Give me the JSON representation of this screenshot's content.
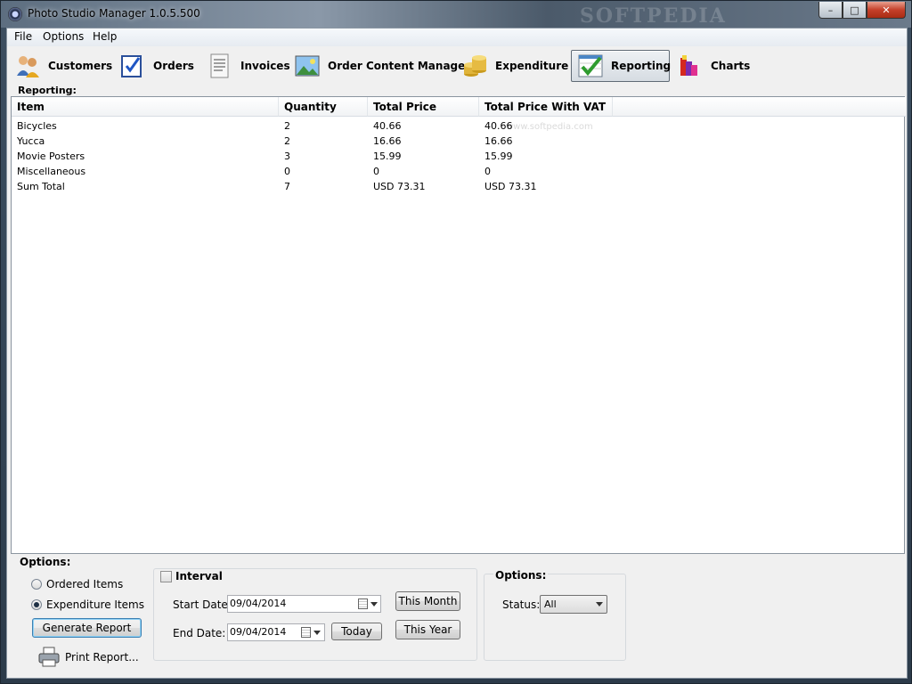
{
  "window": {
    "title": "Photo Studio Manager 1.0.5.500",
    "watermark": "SOFTPEDIA",
    "minimize_glyph": "–",
    "maximize_glyph": "□",
    "close_glyph": "✕"
  },
  "menu": {
    "items": [
      "File",
      "Options",
      "Help"
    ]
  },
  "toolbar": {
    "items": [
      {
        "label": "Customers",
        "icon": "customers-icon"
      },
      {
        "label": "Orders",
        "icon": "orders-icon"
      },
      {
        "label": "Invoices",
        "icon": "invoices-icon"
      },
      {
        "label": "Order Content Manager",
        "icon": "order-content-icon"
      },
      {
        "label": "Expenditure",
        "icon": "coins-icon"
      },
      {
        "label": "Reporting",
        "icon": "reporting-icon"
      },
      {
        "label": "Charts",
        "icon": "charts-icon"
      }
    ],
    "active": "Reporting"
  },
  "reporting": {
    "label": "Reporting:",
    "watermark": "www.softpedia.com",
    "columns": [
      "Item",
      "Quantity",
      "Total Price",
      "Total Price With VAT"
    ],
    "rows": [
      [
        "Bicycles",
        "2",
        "40.66",
        "40.66"
      ],
      [
        "Yucca",
        "2",
        "16.66",
        "16.66"
      ],
      [
        "Movie Posters",
        "3",
        "15.99",
        "15.99"
      ],
      [
        "Miscellaneous",
        "0",
        "0",
        "0"
      ],
      [
        "Sum Total",
        "7",
        "USD 73.31",
        "USD 73.31"
      ]
    ]
  },
  "options": {
    "label": "Options:",
    "ordered_items": "Ordered Items",
    "expenditure_items": "Expenditure Items",
    "selected": "Expenditure Items",
    "generate_report": "Generate Report",
    "print_report": "Print Report..."
  },
  "interval": {
    "label": "Interval",
    "checked": false,
    "start_label": "Start Date:",
    "start_value": "09/04/2014",
    "end_label": "End Date:",
    "end_value": "09/04/2014",
    "this_month": "This Month",
    "today": "Today",
    "this_year": "This Year"
  },
  "status_options": {
    "label": "Options:",
    "status_label": "Status:",
    "status_value": "All"
  },
  "colors": {
    "accent": "#3c7fb1",
    "check_green": "#2e9b2e"
  }
}
